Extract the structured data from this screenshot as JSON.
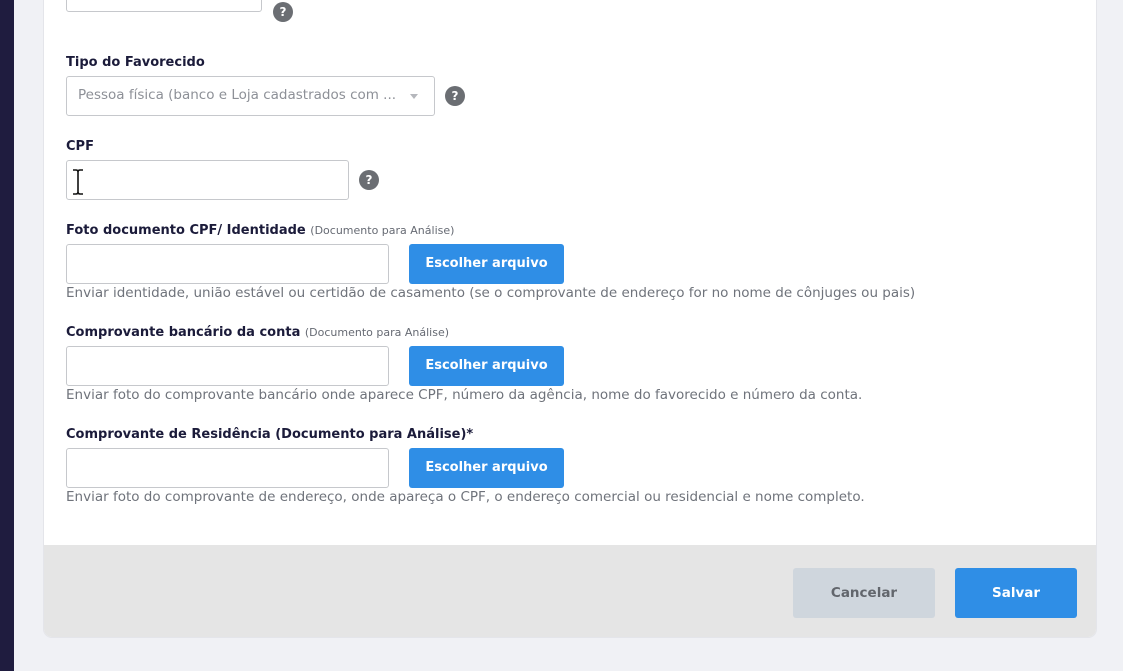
{
  "form": {
    "top_partial": {
      "help_icon": "?"
    },
    "tipo_favorecido": {
      "label": "Tipo do Favorecido",
      "selected_value": "Pessoa física (banco e Loja cadastrados com ...",
      "help_icon": "?"
    },
    "cpf": {
      "label": "CPF",
      "value": "",
      "help_icon": "?"
    },
    "foto_documento": {
      "label": "Foto documento CPF/ Identidade",
      "label_note": "(Documento para Análise)",
      "button_label": "Escolher arquivo",
      "hint": "Enviar identidade, união estável ou certidão de casamento (se o comprovante de endereço for no nome de cônjuges ou pais)"
    },
    "comprovante_bancario": {
      "label": "Comprovante bancário da conta",
      "label_note": "(Documento para Análise)",
      "button_label": "Escolher arquivo",
      "hint": "Enviar foto do comprovante bancário onde aparece CPF, número da agência, nome do favorecido e número da conta."
    },
    "comprovante_residencia": {
      "label": "Comprovante de Residência (Documento para Análise)*",
      "button_label": "Escolher arquivo",
      "hint": "Enviar foto do comprovante de endereço, onde apareça o CPF, o endereço comercial ou residencial e nome completo."
    }
  },
  "footer": {
    "cancel_label": "Cancelar",
    "save_label": "Salvar"
  },
  "colors": {
    "primary": "#2f8ee6",
    "sidebar": "#1f1c3f",
    "cancel_bg": "#cfd6dd",
    "footer_bg": "#e5e5e5"
  },
  "icons": {
    "help": "question-circle-icon",
    "cursor": "text-cursor-icon",
    "dropdown": "chevron-down-icon"
  }
}
